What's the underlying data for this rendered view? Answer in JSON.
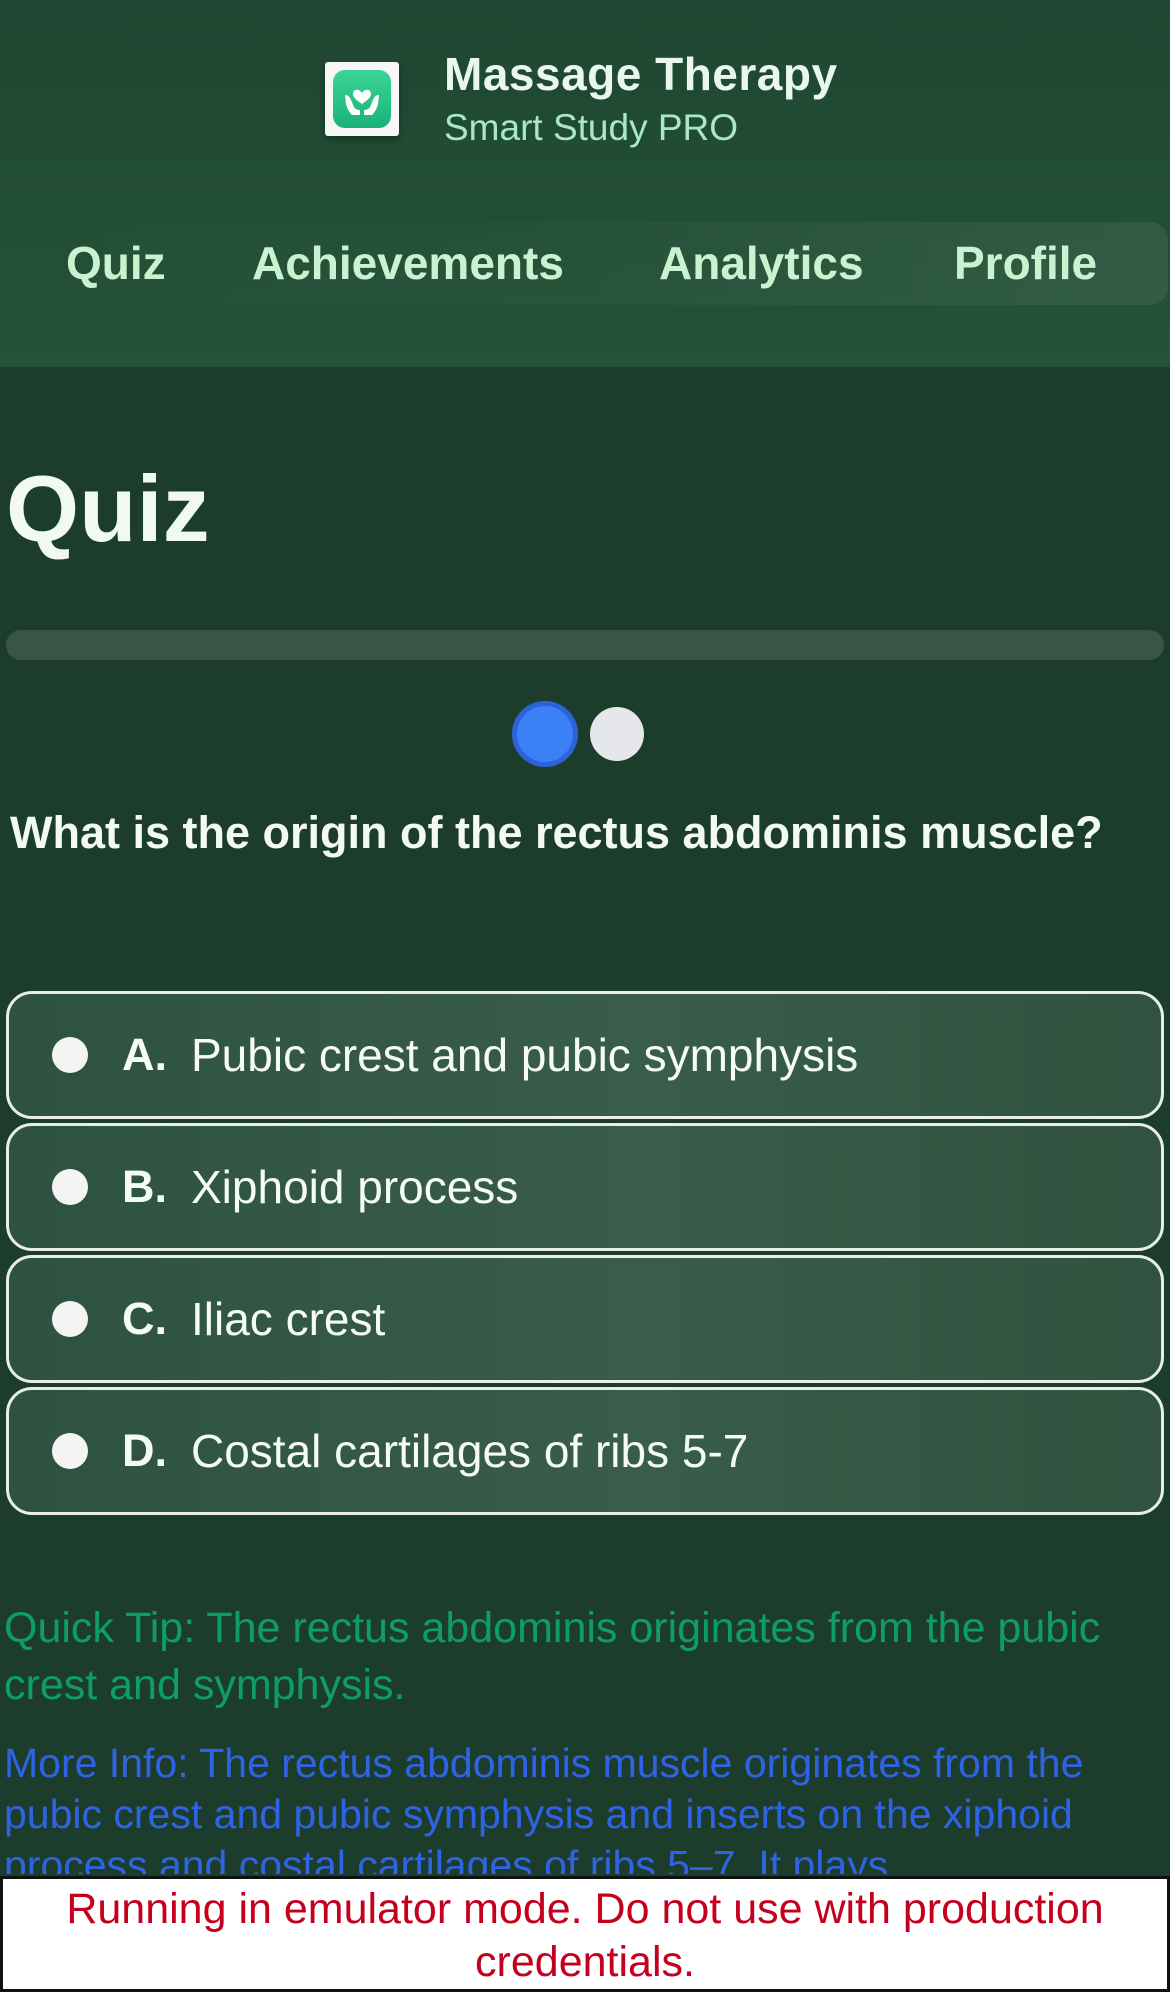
{
  "app": {
    "title": "Massage Therapy",
    "subtitle": "Smart Study PRO",
    "icon": "hands-holding-heart-icon"
  },
  "nav": {
    "items": [
      {
        "label": "Quiz"
      },
      {
        "label": "Achievements"
      },
      {
        "label": "Analytics"
      },
      {
        "label": "Profile"
      }
    ]
  },
  "page": {
    "title": "Quiz"
  },
  "quiz": {
    "progress_percent": 0,
    "question_steps": 2,
    "current_step": 1,
    "question": "What is the origin of the rectus abdominis muscle?",
    "options": [
      {
        "letter": "A.",
        "text": "Pubic crest and pubic symphysis"
      },
      {
        "letter": "B.",
        "text": "Xiphoid process"
      },
      {
        "letter": "C.",
        "text": "Iliac crest"
      },
      {
        "letter": "D.",
        "text": "Costal cartilages of ribs 5-7"
      }
    ],
    "tip": "Quick Tip: The rectus abdominis originates from the pubic crest and symphysis.",
    "more_info": "More Info: The rectus abdominis muscle originates from the pubic crest and pubic symphysis and inserts on the xiphoid process and costal cartilages of ribs 5–7. It plays"
  },
  "banner": {
    "text": "Running in emulator mode. Do not use with production credentials."
  },
  "colors": {
    "background": "#1d3d2c",
    "accent_blue": "#3c80f6",
    "tip_green": "#0f9d67",
    "info_blue": "#2f63e6",
    "warning_red": "#c4001e"
  }
}
